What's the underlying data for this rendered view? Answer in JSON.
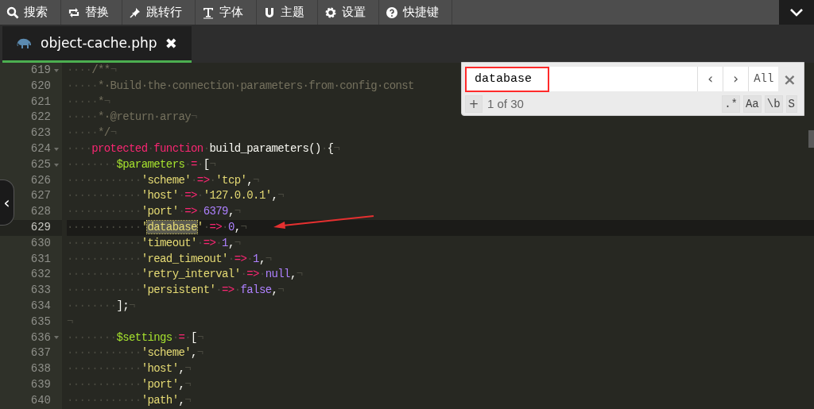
{
  "toolbar": [
    {
      "label": "搜索"
    },
    {
      "label": "替换"
    },
    {
      "label": "跳转行"
    },
    {
      "label": "字体"
    },
    {
      "label": "主题"
    },
    {
      "label": "设置"
    },
    {
      "label": "快捷键"
    }
  ],
  "tabs": [
    {
      "label": "object-cache.php",
      "selected": true,
      "close": "✖"
    }
  ],
  "editor": {
    "lines": [
      {
        "number": "619",
        "fold": true,
        "active": false,
        "tokens": [
          {
            "kind": "ws",
            "text": "····"
          },
          {
            "kind": "comment",
            "text": "/**"
          },
          {
            "kind": "ws",
            "text": "¬"
          }
        ]
      },
      {
        "number": "620",
        "fold": false,
        "active": false,
        "tokens": [
          {
            "kind": "ws",
            "text": "·····"
          },
          {
            "kind": "comment",
            "text": "*·Build·the·connection·parameters·from·config·const"
          }
        ]
      },
      {
        "number": "621",
        "fold": false,
        "active": false,
        "tokens": [
          {
            "kind": "ws",
            "text": "·····"
          },
          {
            "kind": "comment",
            "text": "*"
          },
          {
            "kind": "ws",
            "text": "¬"
          }
        ]
      },
      {
        "number": "622",
        "fold": false,
        "active": false,
        "tokens": [
          {
            "kind": "ws",
            "text": "·····"
          },
          {
            "kind": "comment",
            "text": "*·@return·array"
          },
          {
            "kind": "ws",
            "text": "¬"
          }
        ]
      },
      {
        "number": "623",
        "fold": false,
        "active": false,
        "tokens": [
          {
            "kind": "ws",
            "text": "·····"
          },
          {
            "kind": "comment",
            "text": "*/"
          },
          {
            "kind": "ws",
            "text": "¬"
          }
        ]
      },
      {
        "number": "624",
        "fold": true,
        "active": false,
        "tokens": [
          {
            "kind": "ws",
            "text": "····"
          },
          {
            "kind": "keyword",
            "text": "protected"
          },
          {
            "kind": "ws",
            "text": "·"
          },
          {
            "kind": "keyword",
            "text": "function"
          },
          {
            "kind": "ws",
            "text": "·"
          },
          {
            "kind": "plain",
            "text": "build_parameters()"
          },
          {
            "kind": "ws",
            "text": "·"
          },
          {
            "kind": "plain",
            "text": "{"
          },
          {
            "kind": "ws",
            "text": "¬"
          }
        ]
      },
      {
        "number": "625",
        "fold": true,
        "active": false,
        "tokens": [
          {
            "kind": "ws",
            "text": "········"
          },
          {
            "kind": "variable",
            "text": "$parameters"
          },
          {
            "kind": "ws",
            "text": "·"
          },
          {
            "kind": "operator",
            "text": "="
          },
          {
            "kind": "ws",
            "text": "·"
          },
          {
            "kind": "plain",
            "text": "["
          },
          {
            "kind": "ws",
            "text": "¬"
          }
        ]
      },
      {
        "number": "626",
        "fold": false,
        "active": false,
        "tokens": [
          {
            "kind": "ws",
            "text": "············"
          },
          {
            "kind": "string",
            "text": "'scheme'"
          },
          {
            "kind": "ws",
            "text": "·"
          },
          {
            "kind": "operator",
            "text": "=>"
          },
          {
            "kind": "ws",
            "text": "·"
          },
          {
            "kind": "string",
            "text": "'tcp'"
          },
          {
            "kind": "plain",
            "text": ","
          },
          {
            "kind": "ws",
            "text": "¬"
          }
        ]
      },
      {
        "number": "627",
        "fold": false,
        "active": false,
        "tokens": [
          {
            "kind": "ws",
            "text": "············"
          },
          {
            "kind": "string",
            "text": "'host'"
          },
          {
            "kind": "ws",
            "text": "·"
          },
          {
            "kind": "operator",
            "text": "=>"
          },
          {
            "kind": "ws",
            "text": "·"
          },
          {
            "kind": "string",
            "text": "'127.0.0.1'"
          },
          {
            "kind": "plain",
            "text": ","
          },
          {
            "kind": "ws",
            "text": "¬"
          }
        ]
      },
      {
        "number": "628",
        "fold": false,
        "active": false,
        "tokens": [
          {
            "kind": "ws",
            "text": "············"
          },
          {
            "kind": "string",
            "text": "'port'"
          },
          {
            "kind": "ws",
            "text": "·"
          },
          {
            "kind": "operator",
            "text": "=>"
          },
          {
            "kind": "ws",
            "text": "·"
          },
          {
            "kind": "number",
            "text": "6379"
          },
          {
            "kind": "plain",
            "text": ","
          },
          {
            "kind": "ws",
            "text": "¬"
          }
        ]
      },
      {
        "number": "629",
        "fold": false,
        "active": true,
        "tokens": [
          {
            "kind": "ws",
            "text": "············"
          },
          {
            "kind": "string",
            "text": "'"
          },
          {
            "kind": "match",
            "text": "database"
          },
          {
            "kind": "string",
            "text": "'"
          },
          {
            "kind": "ws",
            "text": "·"
          },
          {
            "kind": "operator",
            "text": "=>"
          },
          {
            "kind": "ws",
            "text": "·"
          },
          {
            "kind": "number",
            "text": "0"
          },
          {
            "kind": "plain",
            "text": ","
          },
          {
            "kind": "ws",
            "text": "¬"
          }
        ]
      },
      {
        "number": "630",
        "fold": false,
        "active": false,
        "tokens": [
          {
            "kind": "ws",
            "text": "············"
          },
          {
            "kind": "string",
            "text": "'timeout'"
          },
          {
            "kind": "ws",
            "text": "·"
          },
          {
            "kind": "operator",
            "text": "=>"
          },
          {
            "kind": "ws",
            "text": "·"
          },
          {
            "kind": "number",
            "text": "1"
          },
          {
            "kind": "plain",
            "text": ","
          },
          {
            "kind": "ws",
            "text": "¬"
          }
        ]
      },
      {
        "number": "631",
        "fold": false,
        "active": false,
        "tokens": [
          {
            "kind": "ws",
            "text": "············"
          },
          {
            "kind": "string",
            "text": "'read_timeout'"
          },
          {
            "kind": "ws",
            "text": "·"
          },
          {
            "kind": "operator",
            "text": "=>"
          },
          {
            "kind": "ws",
            "text": "·"
          },
          {
            "kind": "number",
            "text": "1"
          },
          {
            "kind": "plain",
            "text": ","
          },
          {
            "kind": "ws",
            "text": "¬"
          }
        ]
      },
      {
        "number": "632",
        "fold": false,
        "active": false,
        "tokens": [
          {
            "kind": "ws",
            "text": "············"
          },
          {
            "kind": "string",
            "text": "'retry_interval'"
          },
          {
            "kind": "ws",
            "text": "·"
          },
          {
            "kind": "operator",
            "text": "=>"
          },
          {
            "kind": "ws",
            "text": "·"
          },
          {
            "kind": "number",
            "text": "null"
          },
          {
            "kind": "plain",
            "text": ","
          },
          {
            "kind": "ws",
            "text": "¬"
          }
        ]
      },
      {
        "number": "633",
        "fold": false,
        "active": false,
        "tokens": [
          {
            "kind": "ws",
            "text": "············"
          },
          {
            "kind": "string",
            "text": "'persistent'"
          },
          {
            "kind": "ws",
            "text": "·"
          },
          {
            "kind": "operator",
            "text": "=>"
          },
          {
            "kind": "ws",
            "text": "·"
          },
          {
            "kind": "number",
            "text": "false"
          },
          {
            "kind": "plain",
            "text": ","
          },
          {
            "kind": "ws",
            "text": "¬"
          }
        ]
      },
      {
        "number": "634",
        "fold": false,
        "active": false,
        "tokens": [
          {
            "kind": "ws",
            "text": "········"
          },
          {
            "kind": "plain",
            "text": "];"
          },
          {
            "kind": "ws",
            "text": "¬"
          }
        ]
      },
      {
        "number": "635",
        "fold": false,
        "active": false,
        "tokens": [
          {
            "kind": "ws",
            "text": "¬"
          }
        ]
      },
      {
        "number": "636",
        "fold": true,
        "active": false,
        "tokens": [
          {
            "kind": "ws",
            "text": "········"
          },
          {
            "kind": "variable",
            "text": "$settings"
          },
          {
            "kind": "ws",
            "text": "·"
          },
          {
            "kind": "operator",
            "text": "="
          },
          {
            "kind": "ws",
            "text": "·"
          },
          {
            "kind": "plain",
            "text": "["
          },
          {
            "kind": "ws",
            "text": "¬"
          }
        ]
      },
      {
        "number": "637",
        "fold": false,
        "active": false,
        "tokens": [
          {
            "kind": "ws",
            "text": "············"
          },
          {
            "kind": "string",
            "text": "'scheme'"
          },
          {
            "kind": "plain",
            "text": ","
          },
          {
            "kind": "ws",
            "text": "¬"
          }
        ]
      },
      {
        "number": "638",
        "fold": false,
        "active": false,
        "tokens": [
          {
            "kind": "ws",
            "text": "············"
          },
          {
            "kind": "string",
            "text": "'host'"
          },
          {
            "kind": "plain",
            "text": ","
          },
          {
            "kind": "ws",
            "text": "¬"
          }
        ]
      },
      {
        "number": "639",
        "fold": false,
        "active": false,
        "tokens": [
          {
            "kind": "ws",
            "text": "············"
          },
          {
            "kind": "string",
            "text": "'port'"
          },
          {
            "kind": "plain",
            "text": ","
          },
          {
            "kind": "ws",
            "text": "¬"
          }
        ]
      },
      {
        "number": "640",
        "fold": false,
        "active": false,
        "tokens": [
          {
            "kind": "ws",
            "text": "············"
          },
          {
            "kind": "string",
            "text": "'path'"
          },
          {
            "kind": "plain",
            "text": ","
          },
          {
            "kind": "ws",
            "text": "¬"
          }
        ]
      }
    ]
  },
  "find_panel": {
    "value": "database",
    "prev": "‹",
    "next": "›",
    "all": "All",
    "close": "×",
    "add": "+",
    "count": "1 of 30",
    "toggles": [
      {
        "label": ".*",
        "on": false
      },
      {
        "label": "Aa",
        "on": false
      },
      {
        "label": "\\b",
        "on": false
      },
      {
        "label": "S",
        "on": false
      }
    ]
  },
  "side_handle": "‹"
}
